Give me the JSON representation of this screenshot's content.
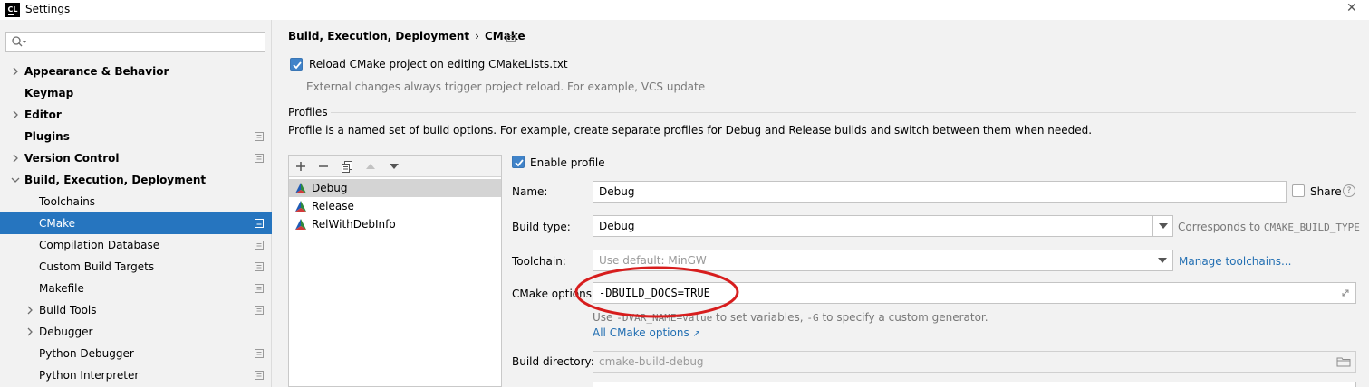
{
  "window": {
    "app_logo": "CL",
    "title": "Settings",
    "close_glyph": "✕"
  },
  "sidebar": {
    "search_placeholder": "",
    "items": [
      {
        "label": "Appearance & Behavior",
        "bold": true,
        "chevron": "right",
        "level": 0,
        "project_icon": false,
        "selected": false
      },
      {
        "label": "Keymap",
        "bold": true,
        "chevron": "none",
        "level": 0,
        "project_icon": false,
        "selected": false
      },
      {
        "label": "Editor",
        "bold": true,
        "chevron": "right",
        "level": 0,
        "project_icon": false,
        "selected": false
      },
      {
        "label": "Plugins",
        "bold": true,
        "chevron": "none",
        "level": 0,
        "project_icon": true,
        "selected": false
      },
      {
        "label": "Version Control",
        "bold": true,
        "chevron": "right",
        "level": 0,
        "project_icon": true,
        "selected": false
      },
      {
        "label": "Build, Execution, Deployment",
        "bold": true,
        "chevron": "down",
        "level": 0,
        "project_icon": false,
        "selected": false
      },
      {
        "label": "Toolchains",
        "bold": false,
        "chevron": "none",
        "level": 1,
        "project_icon": false,
        "selected": false
      },
      {
        "label": "CMake",
        "bold": false,
        "chevron": "none",
        "level": 1,
        "project_icon": true,
        "selected": true
      },
      {
        "label": "Compilation Database",
        "bold": false,
        "chevron": "none",
        "level": 1,
        "project_icon": true,
        "selected": false
      },
      {
        "label": "Custom Build Targets",
        "bold": false,
        "chevron": "none",
        "level": 1,
        "project_icon": true,
        "selected": false
      },
      {
        "label": "Makefile",
        "bold": false,
        "chevron": "none",
        "level": 1,
        "project_icon": true,
        "selected": false
      },
      {
        "label": "Build Tools",
        "bold": false,
        "chevron": "right",
        "level": 1,
        "project_icon": true,
        "selected": false
      },
      {
        "label": "Debugger",
        "bold": false,
        "chevron": "right",
        "level": 1,
        "project_icon": false,
        "selected": false
      },
      {
        "label": "Python Debugger",
        "bold": false,
        "chevron": "none",
        "level": 1,
        "project_icon": true,
        "selected": false
      },
      {
        "label": "Python Interpreter",
        "bold": false,
        "chevron": "none",
        "level": 1,
        "project_icon": true,
        "selected": false
      }
    ]
  },
  "breadcrumb": {
    "parent": "Build, Execution, Deployment",
    "separator": "›",
    "current": "CMake"
  },
  "reload": {
    "checked": true,
    "label": "Reload CMake project on editing CMakeLists.txt",
    "hint": "External changes always trigger project reload. For example, VCS update"
  },
  "profiles": {
    "section_title": "Profiles",
    "description": "Profile is a named set of build options. For example, create separate profiles for Debug and Release builds and switch between them when needed.",
    "list": [
      {
        "name": "Debug",
        "selected": true
      },
      {
        "name": "Release",
        "selected": false
      },
      {
        "name": "RelWithDebInfo",
        "selected": false
      }
    ]
  },
  "form": {
    "enable_profile_label": "Enable profile",
    "enable_profile_checked": true,
    "name_label": "Name:",
    "name_value": "Debug",
    "share_label": "Share",
    "share_checked": false,
    "help_glyph": "?",
    "build_type_label": "Build type:",
    "build_type_value": "Debug",
    "build_type_hint": "Corresponds to",
    "build_type_hint_code": "CMAKE_BUILD_TYPE",
    "toolchain_label": "Toolchain:",
    "toolchain_value": "Use default: MinGW",
    "manage_toolchains_link": "Manage toolchains...",
    "cmake_options_label": "CMake options:",
    "cmake_options_value": "-DBUILD_DOCS=TRUE",
    "cmake_options_hint_1": "Use",
    "cmake_options_hint_code_1": "-DVAR_NAME=value",
    "cmake_options_hint_2": "to set variables,",
    "cmake_options_hint_code_2": "-G",
    "cmake_options_hint_3": "to specify a custom generator.",
    "all_cmake_options_link": "All CMake options",
    "all_cmake_options_arrow": "↗",
    "build_directory_label": "Build directory:",
    "build_directory_value": "cmake-build-debug"
  },
  "colors": {
    "selection_blue": "#2675bf",
    "checkbox_blue": "#4083c9",
    "link_blue": "#2470b3",
    "annotation_red": "#d71d1d"
  }
}
